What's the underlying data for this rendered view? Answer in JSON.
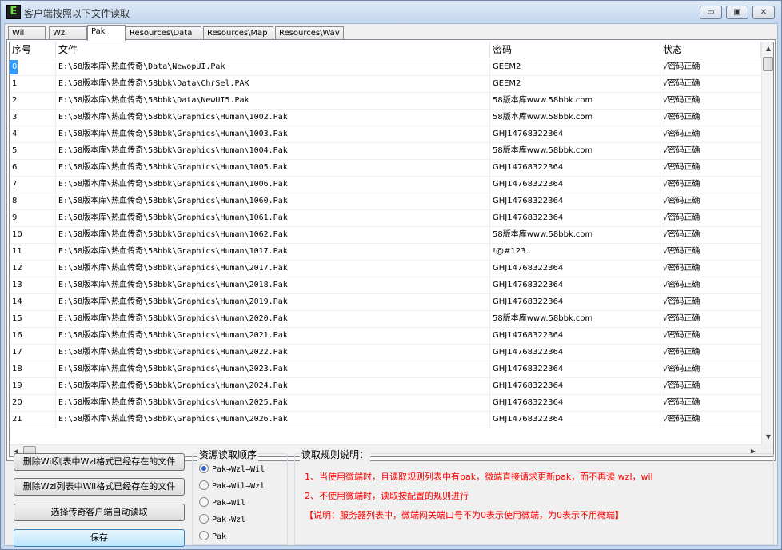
{
  "window": {
    "title": "客户端按照以下文件读取",
    "app_icon_letter": "E",
    "min_glyph": "▭",
    "max_glyph": "▣",
    "close_glyph": "✕"
  },
  "tabs": [
    {
      "label": "Wil",
      "active": false
    },
    {
      "label": "Wzl",
      "active": false
    },
    {
      "label": "Pak",
      "active": true
    },
    {
      "label": "Resources\\Data",
      "active": false
    },
    {
      "label": "Resources\\Map",
      "active": false
    },
    {
      "label": "Resources\\Wav",
      "active": false
    }
  ],
  "list": {
    "columns": [
      "序号",
      "文件",
      "密码",
      "状态"
    ],
    "rows": [
      {
        "idx": "0",
        "file": "E:\\58版本库\\热血传奇\\Data\\NewopUI.Pak",
        "password": "GEEM2",
        "status": "√密码正确"
      },
      {
        "idx": "1",
        "file": "E:\\58版本库\\热血传奇\\58bbk\\Data\\ChrSel.PAK",
        "password": "GEEM2",
        "status": "√密码正确"
      },
      {
        "idx": "2",
        "file": "E:\\58版本库\\热血传奇\\58bbk\\Data\\NewUI5.Pak",
        "password": "58版本库www.58bbk.com",
        "status": "√密码正确"
      },
      {
        "idx": "3",
        "file": "E:\\58版本库\\热血传奇\\58bbk\\Graphics\\Human\\1002.Pak",
        "password": "58版本库www.58bbk.com",
        "status": "√密码正确"
      },
      {
        "idx": "4",
        "file": "E:\\58版本库\\热血传奇\\58bbk\\Graphics\\Human\\1003.Pak",
        "password": "GHJ14768322364",
        "status": "√密码正确"
      },
      {
        "idx": "5",
        "file": "E:\\58版本库\\热血传奇\\58bbk\\Graphics\\Human\\1004.Pak",
        "password": "58版本库www.58bbk.com",
        "status": "√密码正确"
      },
      {
        "idx": "6",
        "file": "E:\\58版本库\\热血传奇\\58bbk\\Graphics\\Human\\1005.Pak",
        "password": "GHJ14768322364",
        "status": "√密码正确"
      },
      {
        "idx": "7",
        "file": "E:\\58版本库\\热血传奇\\58bbk\\Graphics\\Human\\1006.Pak",
        "password": "GHJ14768322364",
        "status": "√密码正确"
      },
      {
        "idx": "8",
        "file": "E:\\58版本库\\热血传奇\\58bbk\\Graphics\\Human\\1060.Pak",
        "password": "GHJ14768322364",
        "status": "√密码正确"
      },
      {
        "idx": "9",
        "file": "E:\\58版本库\\热血传奇\\58bbk\\Graphics\\Human\\1061.Pak",
        "password": "GHJ14768322364",
        "status": "√密码正确"
      },
      {
        "idx": "10",
        "file": "E:\\58版本库\\热血传奇\\58bbk\\Graphics\\Human\\1062.Pak",
        "password": "58版本库www.58bbk.com",
        "status": "√密码正确"
      },
      {
        "idx": "11",
        "file": "E:\\58版本库\\热血传奇\\58bbk\\Graphics\\Human\\1017.Pak",
        "password": "!@#123..",
        "status": "√密码正确"
      },
      {
        "idx": "12",
        "file": "E:\\58版本库\\热血传奇\\58bbk\\Graphics\\Human\\2017.Pak",
        "password": "GHJ14768322364",
        "status": "√密码正确"
      },
      {
        "idx": "13",
        "file": "E:\\58版本库\\热血传奇\\58bbk\\Graphics\\Human\\2018.Pak",
        "password": "GHJ14768322364",
        "status": "√密码正确"
      },
      {
        "idx": "14",
        "file": "E:\\58版本库\\热血传奇\\58bbk\\Graphics\\Human\\2019.Pak",
        "password": "GHJ14768322364",
        "status": "√密码正确"
      },
      {
        "idx": "15",
        "file": "E:\\58版本库\\热血传奇\\58bbk\\Graphics\\Human\\2020.Pak",
        "password": "58版本库www.58bbk.com",
        "status": "√密码正确"
      },
      {
        "idx": "16",
        "file": "E:\\58版本库\\热血传奇\\58bbk\\Graphics\\Human\\2021.Pak",
        "password": "GHJ14768322364",
        "status": "√密码正确"
      },
      {
        "idx": "17",
        "file": "E:\\58版本库\\热血传奇\\58bbk\\Graphics\\Human\\2022.Pak",
        "password": "GHJ14768322364",
        "status": "√密码正确"
      },
      {
        "idx": "18",
        "file": "E:\\58版本库\\热血传奇\\58bbk\\Graphics\\Human\\2023.Pak",
        "password": "GHJ14768322364",
        "status": "√密码正确"
      },
      {
        "idx": "19",
        "file": "E:\\58版本库\\热血传奇\\58bbk\\Graphics\\Human\\2024.Pak",
        "password": "GHJ14768322364",
        "status": "√密码正确"
      },
      {
        "idx": "20",
        "file": "E:\\58版本库\\热血传奇\\58bbk\\Graphics\\Human\\2025.Pak",
        "password": "GHJ14768322364",
        "status": "√密码正确"
      },
      {
        "idx": "21",
        "file": "E:\\58版本库\\热血传奇\\58bbk\\Graphics\\Human\\2026.Pak",
        "password": "GHJ14768322364",
        "status": "√密码正确"
      }
    ]
  },
  "buttons": {
    "delete_wzl_in_wil": "删除Wil列表中Wzl格式已经存在的文件",
    "delete_wil_in_wzl": "删除Wzl列表中Wil格式已经存在的文件",
    "auto_read": "选择传奇客户端自动读取",
    "save": "保存"
  },
  "order_group": {
    "title": "资源读取顺序",
    "options": [
      {
        "label": "Pak→Wzl→Wil",
        "checked": true
      },
      {
        "label": "Pak→Wil→Wzl",
        "checked": false
      },
      {
        "label": "Pak→Wil",
        "checked": false
      },
      {
        "label": "Pak→Wzl",
        "checked": false
      },
      {
        "label": "Pak",
        "checked": false
      }
    ]
  },
  "rules_group": {
    "title": "读取规则说明：",
    "lines": [
      "1、当使用微端时，且读取规则列表中有pak，微端直接请求更新pak，而不再读 wzl，wil",
      "2、不使用微端时，读取按配置的规则进行",
      "【说明：服务器列表中，微端网关端口号不为0表示使用微端，为0表示不用微端】"
    ]
  },
  "colors": {
    "selection": "#3399ff",
    "rule_text": "#ff0000"
  }
}
